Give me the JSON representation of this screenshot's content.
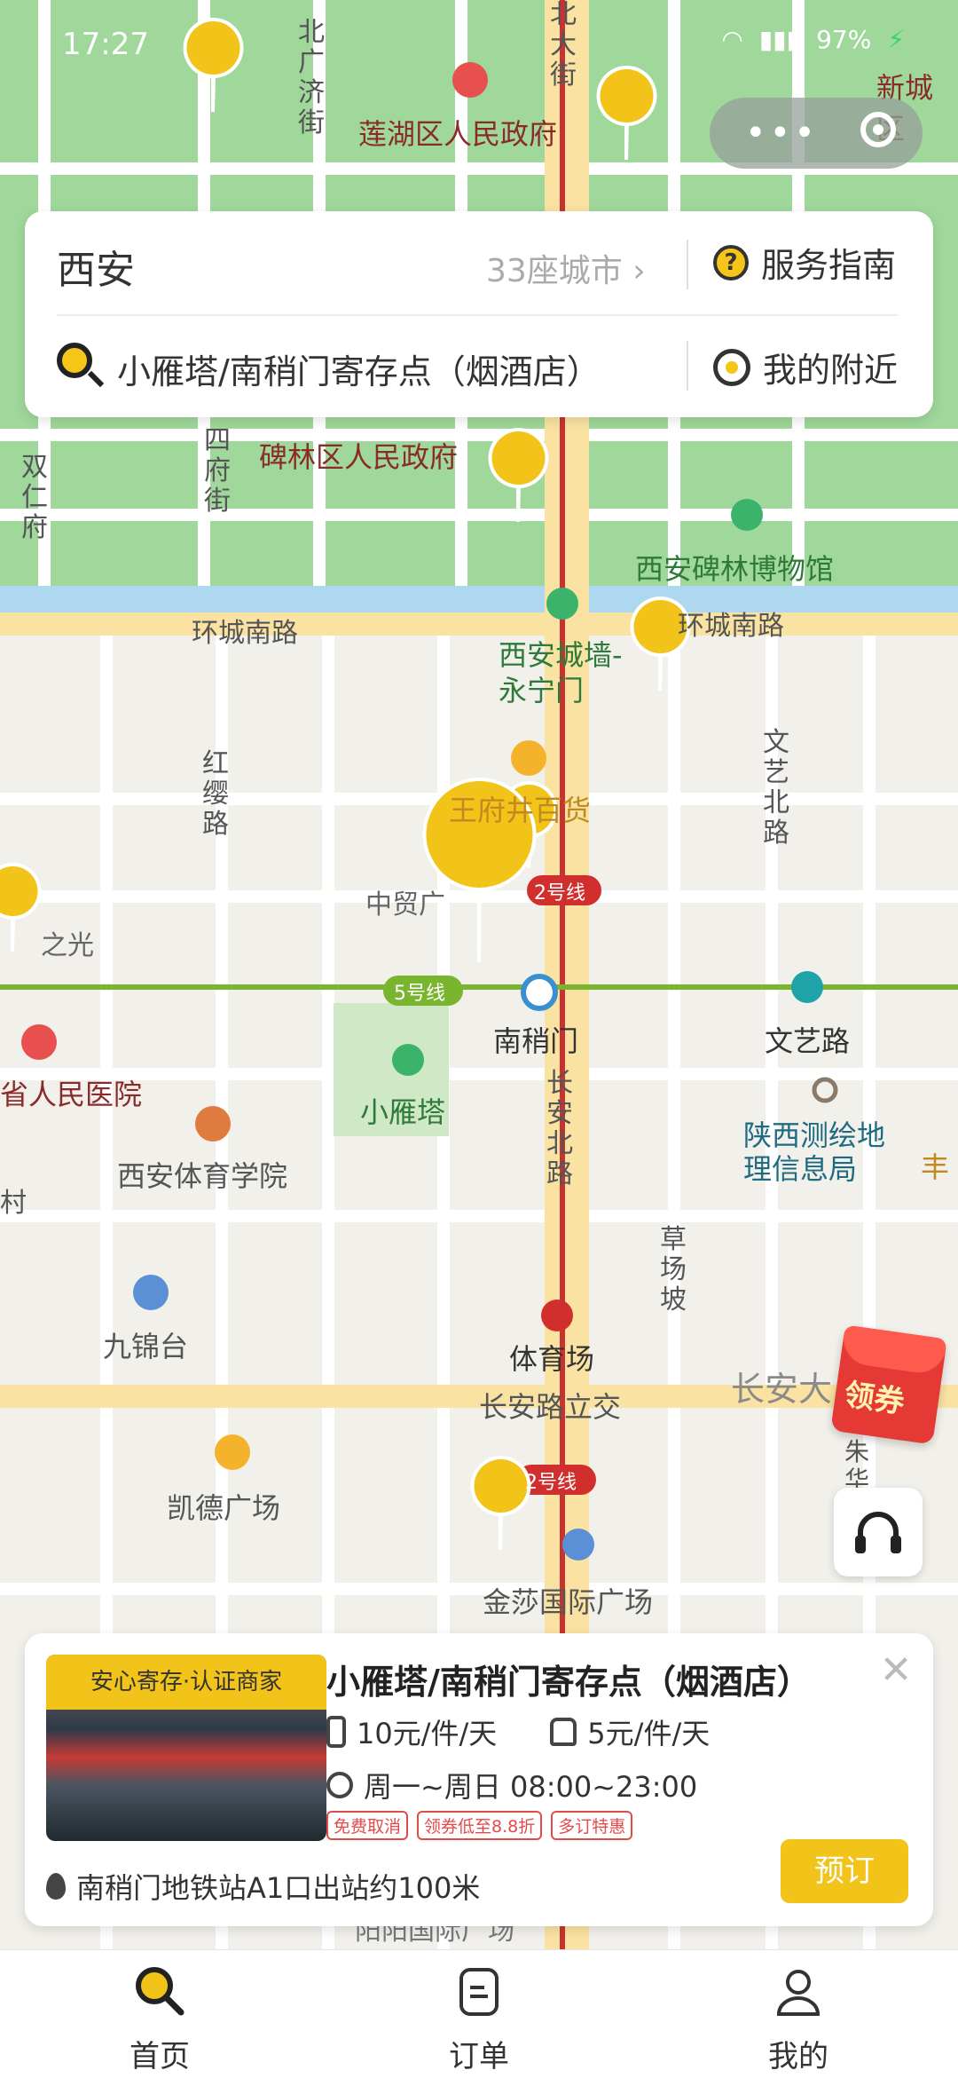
{
  "status": {
    "time": "17:27",
    "battery": "97%"
  },
  "search_card": {
    "city": "西安",
    "city_count": "33座城市",
    "guide_label": "服务指南",
    "search_text": "小雁塔/南稍门寄存点（烟酒店）",
    "nearby_label": "我的附近"
  },
  "map": {
    "streets": [
      "北广济街",
      "北大街",
      "四府街",
      "双仁府",
      "环城南路",
      "环城南路",
      "红缨路",
      "文艺北路",
      "长安北路",
      "草场坡",
      "长安大",
      "朱华",
      "村"
    ],
    "pois": [
      "莲湖区人民政府",
      "碑林区人民政府",
      "西安碑林博物馆",
      "西安城墙-永宁门",
      "王府井百货",
      "中贸广",
      "之光",
      "省人民医院",
      "西安体育学院",
      "小雁塔",
      "南稍门",
      "文艺路",
      "陕西测绘地理信息局",
      "九锦台",
      "体育场",
      "长安路立交",
      "凯德广场",
      "金莎国际广场",
      "新城区",
      "丰",
      "阳阳国际广场"
    ],
    "line_badges": [
      "2号线",
      "5号线",
      "2号线"
    ]
  },
  "coupon": {
    "label": "领券"
  },
  "store": {
    "tag": "安心寄存·认证商家",
    "name": "小雁塔/南稍门寄存点（烟酒店）",
    "price_luggage": "10元/件/天",
    "price_bag": "5元/件/天",
    "hours": "周一~周日 08:00~23:00",
    "badges": [
      "免费取消",
      "领券低至8.8折",
      "多订特惠"
    ],
    "location": "南稍门地铁站A1口出站约100米",
    "book_label": "预订"
  },
  "tabs": [
    {
      "label": "首页",
      "icon": "home-search-icon"
    },
    {
      "label": "订单",
      "icon": "order-icon"
    },
    {
      "label": "我的",
      "icon": "profile-icon"
    }
  ]
}
